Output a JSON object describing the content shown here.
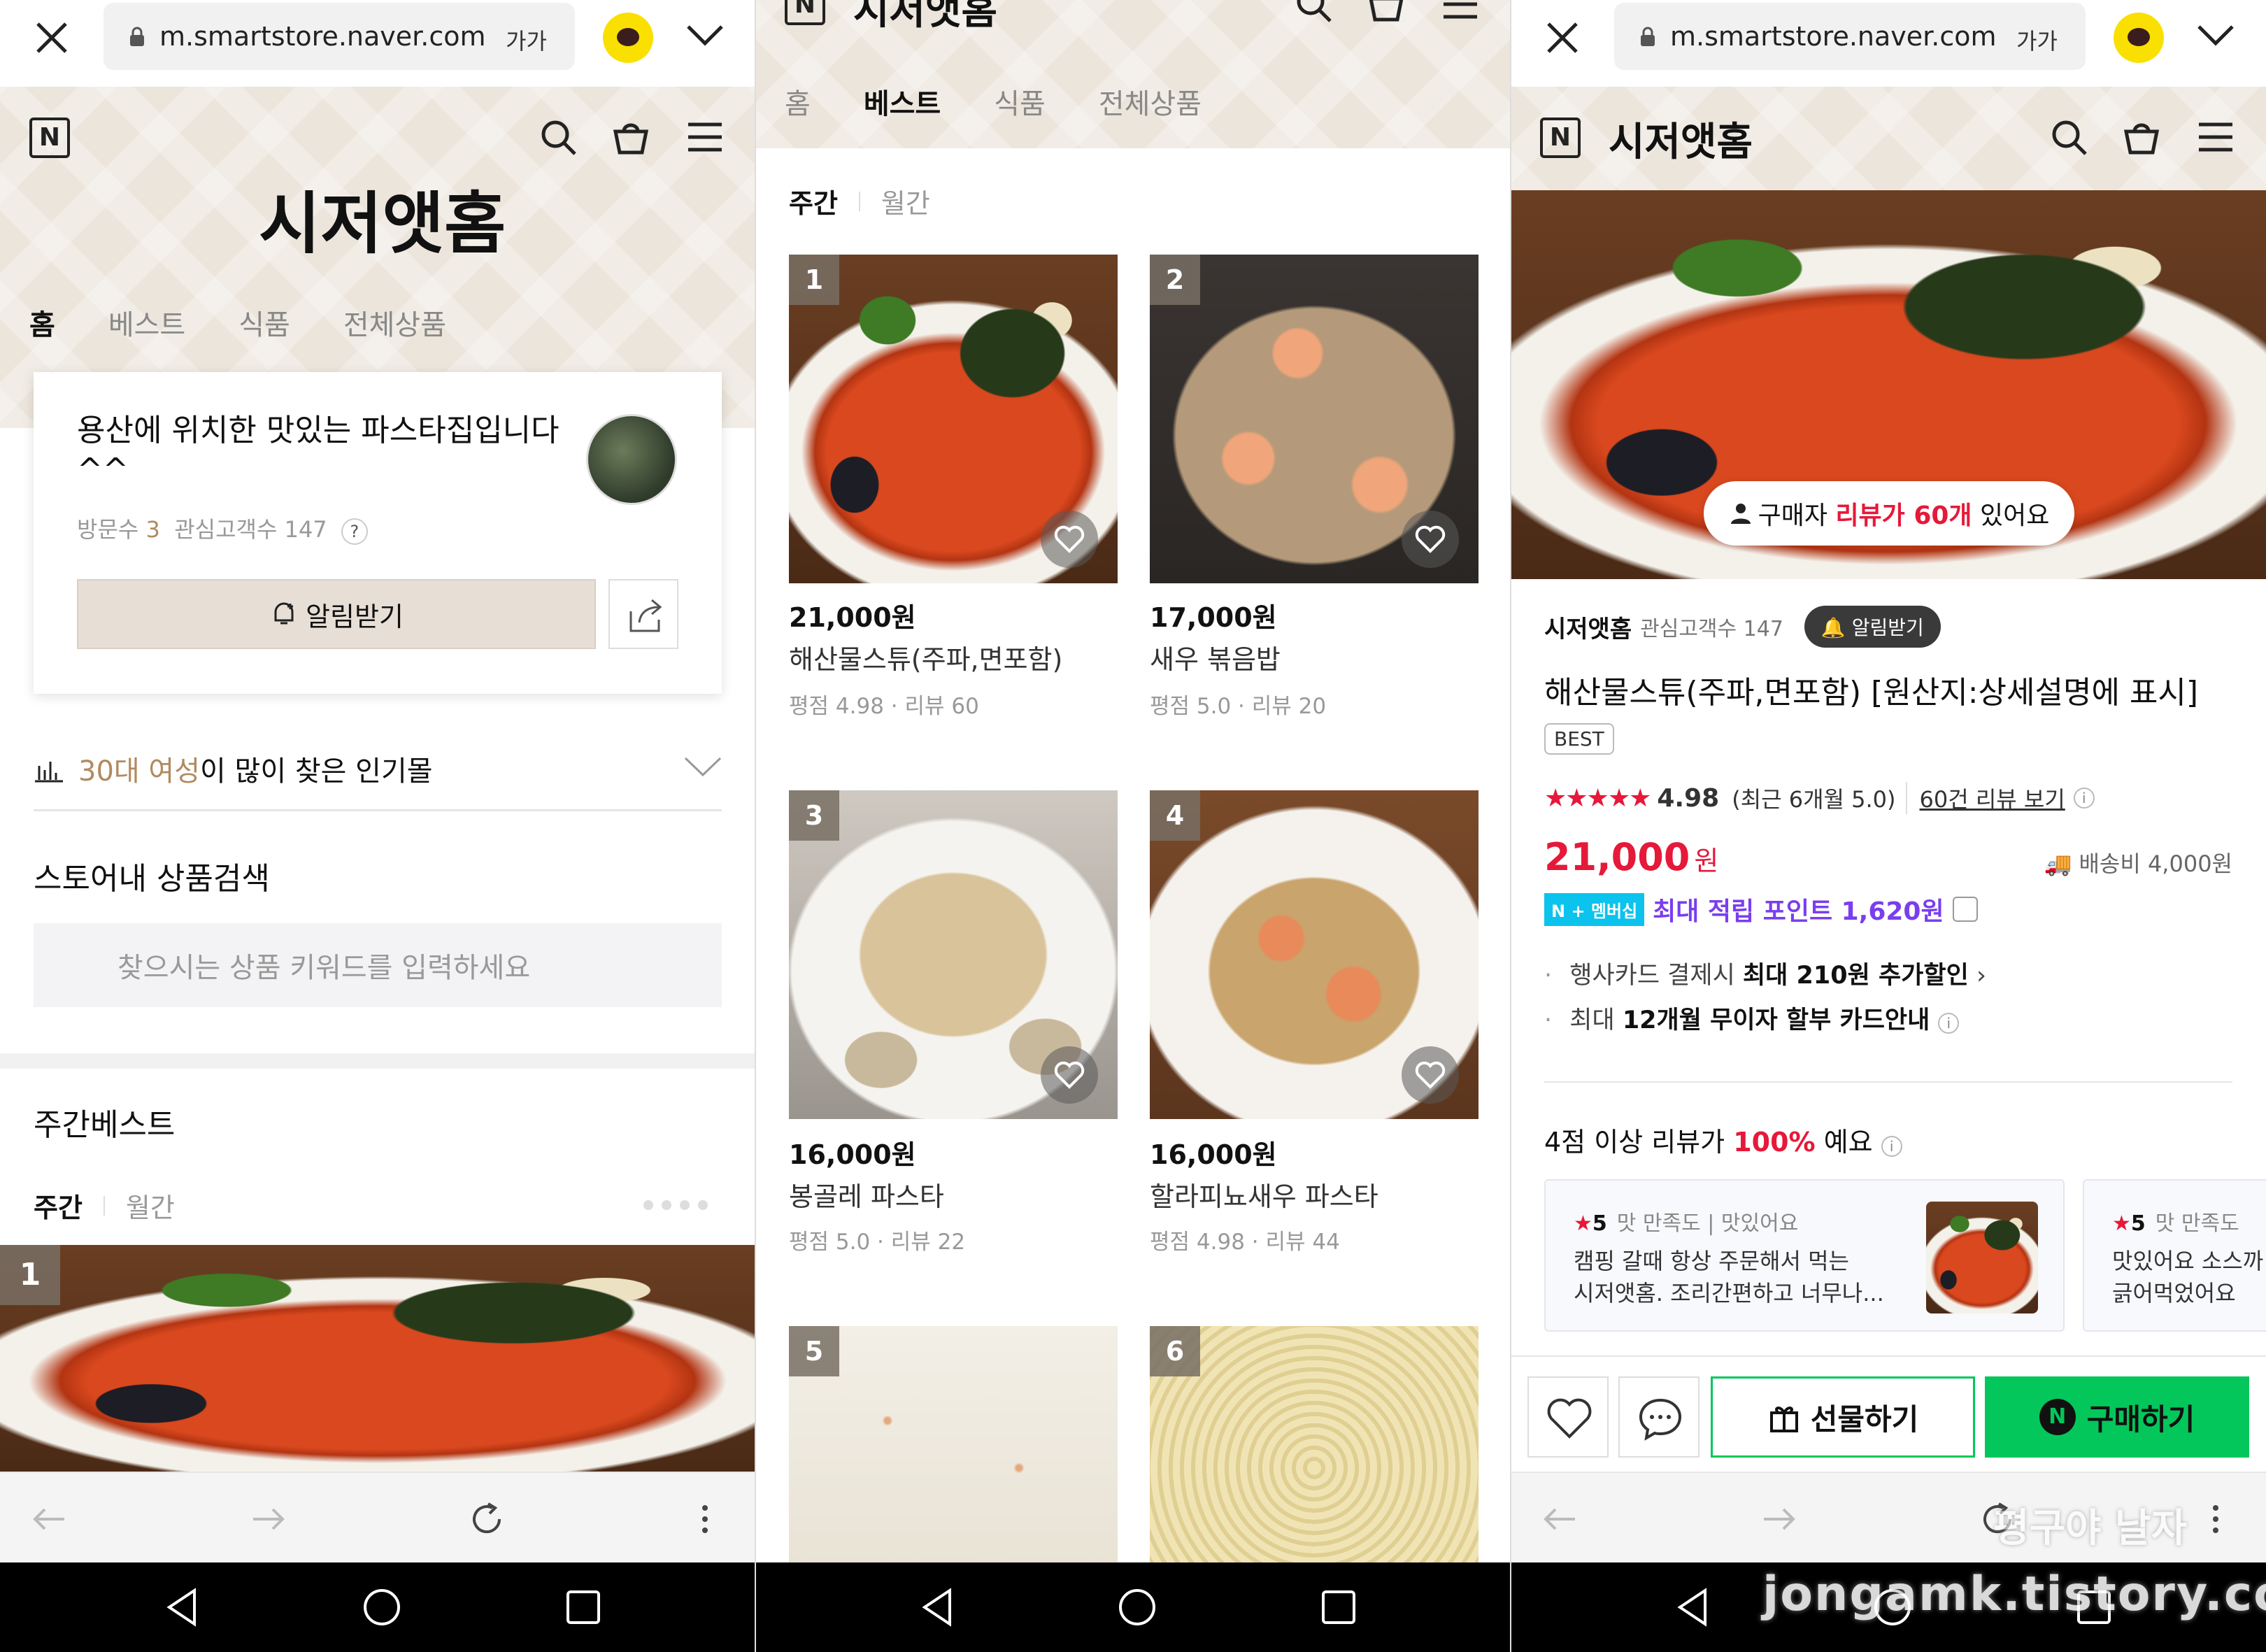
{
  "browser": {
    "url": "m.smartstore.naver.com",
    "text_size_label": "가가"
  },
  "store": {
    "name": "시저앳홈",
    "logo_letter": "N",
    "tabs": [
      "홈",
      "베스트",
      "식품",
      "전체상품"
    ],
    "description": "용산에 위치한 맛있는 파스타집입니다^^",
    "visitors_label": "방문수",
    "visitors": "3",
    "followers_label": "관심고객수",
    "followers": "147",
    "help_glyph": "?",
    "notify_label": "알림받기",
    "popular": {
      "highlight": "30대 여성",
      "rest": "이 많이 찾은 인기몰"
    },
    "search_title": "스토어내 상품검색",
    "search_placeholder": "찾으시는 상품 키워드를 입력하세요",
    "weekly_best_title": "주간베스트",
    "period_weekly": "주간",
    "period_monthly": "월간"
  },
  "products": [
    {
      "rank": "1",
      "price": "21,000원",
      "name": "해산물스튜(주파,면포함)",
      "rating": "평점 4.98 · 리뷰 60"
    },
    {
      "rank": "2",
      "price": "17,000원",
      "name": "새우 볶음밥",
      "rating": "평점 5.0 · 리뷰 20"
    },
    {
      "rank": "3",
      "price": "16,000원",
      "name": "봉골레 파스타",
      "rating": "평점 5.0 · 리뷰 22"
    },
    {
      "rank": "4",
      "price": "16,000원",
      "name": "할라피뇨새우 파스타",
      "rating": "평점 4.98 · 리뷰 44"
    },
    {
      "rank": "5"
    },
    {
      "rank": "6"
    }
  ],
  "detail": {
    "review_pill": {
      "prefix": "구매자",
      "highlight": "리뷰가 60개",
      "suffix": "있어요"
    },
    "seller": "시저앳홈",
    "seller_followers": "관심고객수 147",
    "notify_label": "알림받기",
    "title": "해산물스튜(주파,면포함) [원산지:상세설명에 표시]",
    "best_tag": "BEST",
    "stars": "★★★★★",
    "score": "4.98",
    "recent": "(최근 6개월 5.0)",
    "review_link": "60건 리뷰 보기",
    "info_glyph": "i",
    "price": "21,000",
    "price_unit": "원",
    "shipping": "배송비 4,000원",
    "membership_badge": "N + 멤버십",
    "points": "최대 적립 포인트 1,620원",
    "benefit1": {
      "pre": "행사카드 결제시",
      "bold": "최대 210원 추가할인",
      "suffix": "›"
    },
    "benefit2": {
      "pre": "최대",
      "bold": "12개월 무이자 할부 카드안내"
    },
    "review_summary": {
      "pre": "4점 이상 리뷰가",
      "highlight": "100%",
      "post": "예요"
    },
    "reviews": [
      {
        "score": "5",
        "tags": "맛 만족도 | 맛있어요",
        "text": "캠핑 갈때 항상 주문해서 먹는\n시저앳홈. 조리간편하고 너무나..."
      },
      {
        "score": "5",
        "tags": "맛 만족도",
        "text": "맛있어요 소스까\n긁어먹었어요"
      }
    ],
    "gift_label": "선물하기",
    "buy_label": "구매하기",
    "buy_badge": "N"
  },
  "watermark": {
    "url": "jongamk.tistory.com",
    "name": "평구야 날자"
  },
  "colors": {
    "accent_red": "#e5193a",
    "naver_green": "#03c75a",
    "brand_beige": "#ece5dc",
    "points_purple": "#7a3eee"
  }
}
